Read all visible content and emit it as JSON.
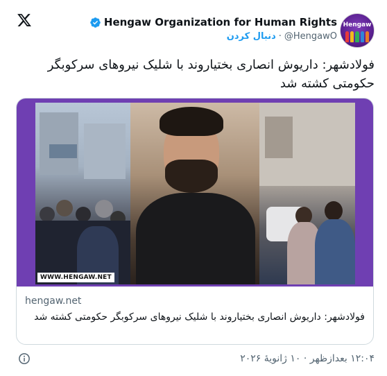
{
  "header": {
    "author_name": "Hengaw Organization for Human Rights",
    "handle": "@HengawO",
    "separator": "·",
    "follow_label": "دنبال کردن",
    "avatar_text": "Hengaw"
  },
  "tweet": {
    "text": "فولادشهر: داریوش انصاری بختیاروند با شلیک نیروهای سرکوبگر حکومتی کشته شد"
  },
  "card": {
    "watermark": "WWW.HENGAW.NET",
    "domain": "hengaw.net",
    "title": "فولادشهر: داریوش انصاری بختیاروند با شلیک نیروهای سرکوبگر حکومتی کشته شد"
  },
  "footer": {
    "timestamp": "۱۲:۰۴ بعدازظهر · ۱۰ ژانویهٔ ۲۰۲۶"
  },
  "colors": {
    "accent": "#1d9bf0",
    "card_border": "#cfd9de",
    "media_purple": "#6f3fb2",
    "secondary_text": "#536471"
  },
  "icons": [
    "x-logo-icon",
    "verified-badge-icon",
    "info-icon"
  ]
}
